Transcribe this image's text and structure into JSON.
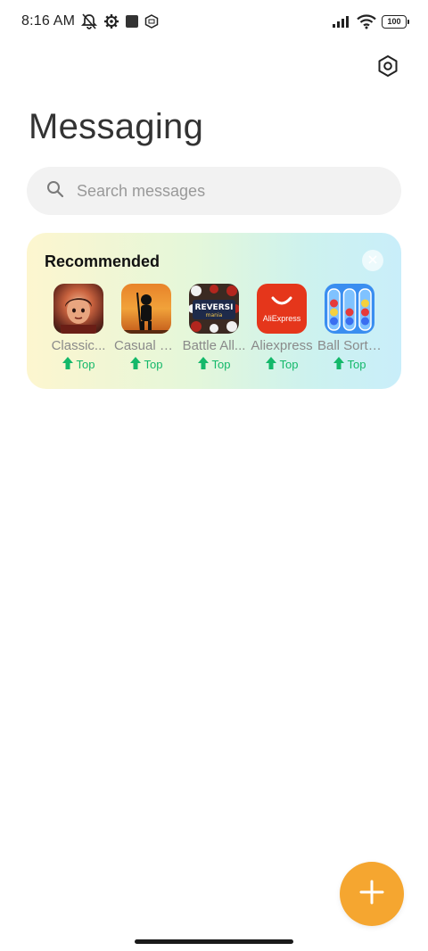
{
  "status_bar": {
    "time": "8:16 AM",
    "battery": "100",
    "left_icons": [
      "alarm-off-icon",
      "settings-cog-icon",
      "square-icon",
      "sim-icon"
    ],
    "right_icons": [
      "signal-icon",
      "wifi-icon",
      "battery-icon"
    ]
  },
  "header": {
    "title": "Messaging",
    "settings_icon": "settings-hexagon-icon"
  },
  "search": {
    "placeholder": "Search messages",
    "value": ""
  },
  "recommended": {
    "title": "Recommended",
    "close_icon": "close-icon",
    "apps": [
      {
        "name": "Classic...",
        "badge": "Top"
      },
      {
        "name": "Casual G...",
        "badge": "Top"
      },
      {
        "name": "Battle All...",
        "badge": "Top"
      },
      {
        "name": "Aliexpress",
        "badge": "Top"
      },
      {
        "name": "Ball Sort:...",
        "badge": "Top"
      }
    ],
    "icon_texts": {
      "reversi_line1": "REVERSI",
      "reversi_line2": "mania",
      "aliexpress_logo": "AliExpress"
    }
  },
  "fab": {
    "icon": "plus-icon",
    "color": "#f5a630"
  },
  "colors": {
    "accent": "#f5a630",
    "badge_green": "#14b86a"
  }
}
